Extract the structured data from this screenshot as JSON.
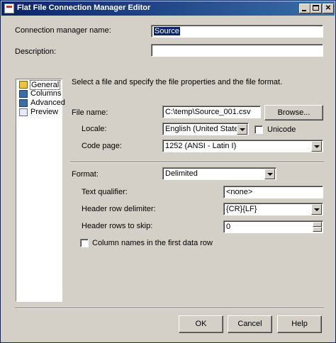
{
  "window": {
    "title": "Flat File Connection Manager Editor"
  },
  "fields": {
    "connection_name_label": "Connection manager name:",
    "connection_name_value": "Source",
    "description_label": "Description:",
    "description_value": ""
  },
  "nav": {
    "items": [
      {
        "label": "General",
        "icon": "general-icon",
        "selected": true
      },
      {
        "label": "Columns",
        "icon": "columns-icon",
        "selected": false
      },
      {
        "label": "Advanced",
        "icon": "advanced-icon",
        "selected": false
      },
      {
        "label": "Preview",
        "icon": "preview-icon",
        "selected": false
      }
    ]
  },
  "general": {
    "intro": "Select a file and specify the file properties and the file format.",
    "file_name_label": "File name:",
    "file_name_value": "C:\\temp\\Source_001.csv",
    "browse_label": "Browse...",
    "locale_label": "Locale:",
    "locale_value": "English (United States)",
    "unicode_label": "Unicode",
    "unicode_checked": false,
    "code_page_label": "Code page:",
    "code_page_value": "1252  (ANSI - Latin I)",
    "format_label": "Format:",
    "format_value": "Delimited",
    "text_qualifier_label": "Text qualifier:",
    "text_qualifier_value": "<none>",
    "header_delim_label": "Header row delimiter:",
    "header_delim_value": "{CR}{LF}",
    "header_skip_label": "Header rows to skip:",
    "header_skip_value": "0",
    "col_names_label": "Column names in the first data row",
    "col_names_checked": false
  },
  "buttons": {
    "ok": "OK",
    "cancel": "Cancel",
    "help": "Help"
  }
}
